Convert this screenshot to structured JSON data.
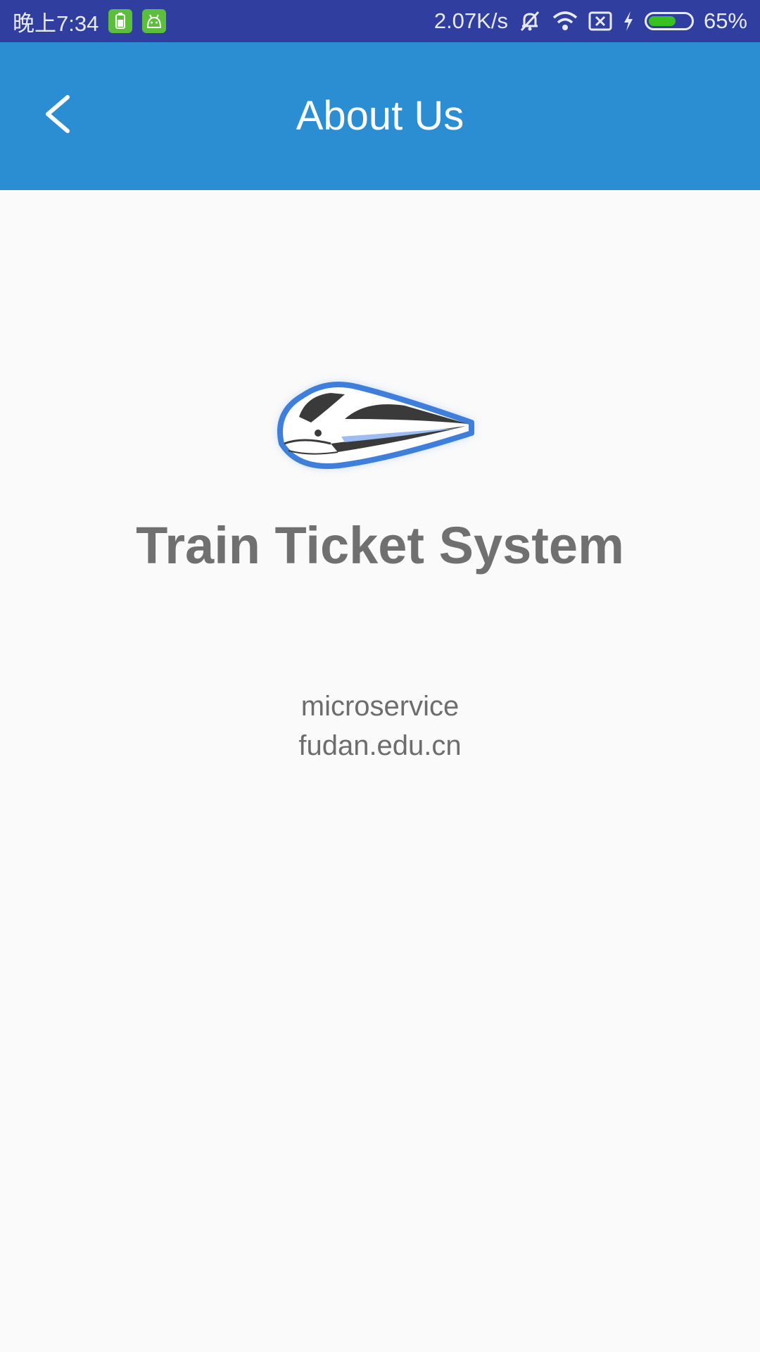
{
  "status_bar": {
    "time": "晚上7:34",
    "network_speed": "2.07K/s",
    "battery_percent": "65%",
    "battery_level": 0.65,
    "icons": [
      "battery-app-icon",
      "android-app-icon",
      "mute-icon",
      "wifi-icon",
      "sim-x-icon",
      "charging-icon",
      "battery-icon"
    ]
  },
  "app_bar": {
    "title": "About Us",
    "back_icon": "chevron-left-icon",
    "background": "#2b8ed3"
  },
  "main": {
    "logo_icon": "train-logo-icon",
    "app_name": "Train Ticket System",
    "line1": "microservice",
    "line2": "fudan.edu.cn"
  },
  "colors": {
    "status_bar": "#303f9f",
    "app_bar": "#2b8ed3",
    "background": "#fafafa",
    "text_gray": "#707070"
  }
}
